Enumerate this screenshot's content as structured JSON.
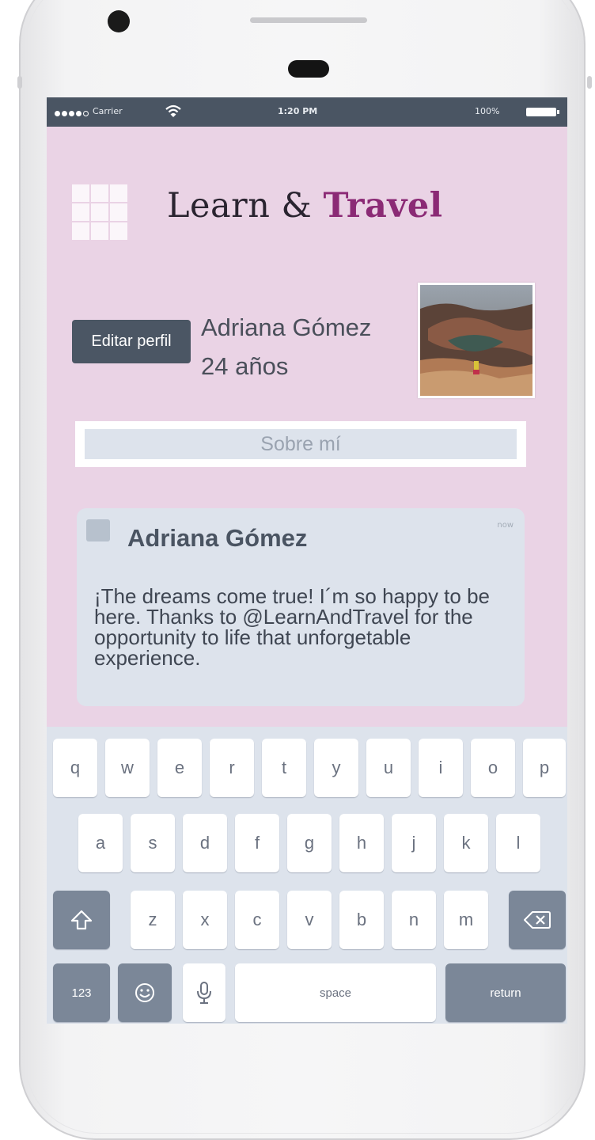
{
  "status_bar": {
    "carrier": "Carrier",
    "time": "1:20 PM",
    "battery": "100%"
  },
  "header": {
    "title_part1": "Learn & ",
    "title_part2": "Travel",
    "menu_icon": "grid-icon"
  },
  "profile": {
    "edit_label": "Editar perfil",
    "name": "Adriana Gómez",
    "age": "24 años",
    "photo_icon": "profile-photo"
  },
  "about": {
    "label": "Sobre mí"
  },
  "post": {
    "author": "Adriana Gómez",
    "time": "now",
    "text": "¡The dreams come true! I´m so happy to be here. Thanks to @LearnAndTravel for the opportunity to life that unforgetable experience."
  },
  "keyboard": {
    "row1": [
      "q",
      "w",
      "e",
      "r",
      "t",
      "y",
      "u",
      "i",
      "o",
      "p"
    ],
    "row2": [
      "a",
      "s",
      "d",
      "f",
      "g",
      "h",
      "j",
      "k",
      "l"
    ],
    "row3": [
      "z",
      "x",
      "c",
      "v",
      "b",
      "n",
      "m"
    ],
    "numbers_label": "123",
    "space_label": "space",
    "return_label": "return",
    "shift_icon": "shift-icon",
    "backspace_icon": "backspace-icon",
    "emoji_icon": "emoji-icon",
    "mic_icon": "microphone-icon"
  },
  "colors": {
    "screen_bg": "#ead3e5",
    "accent": "#8b2a75",
    "status_bar": "#4a5563",
    "keyboard_bg": "#dde3ec",
    "dark_key": "#7b8798"
  }
}
